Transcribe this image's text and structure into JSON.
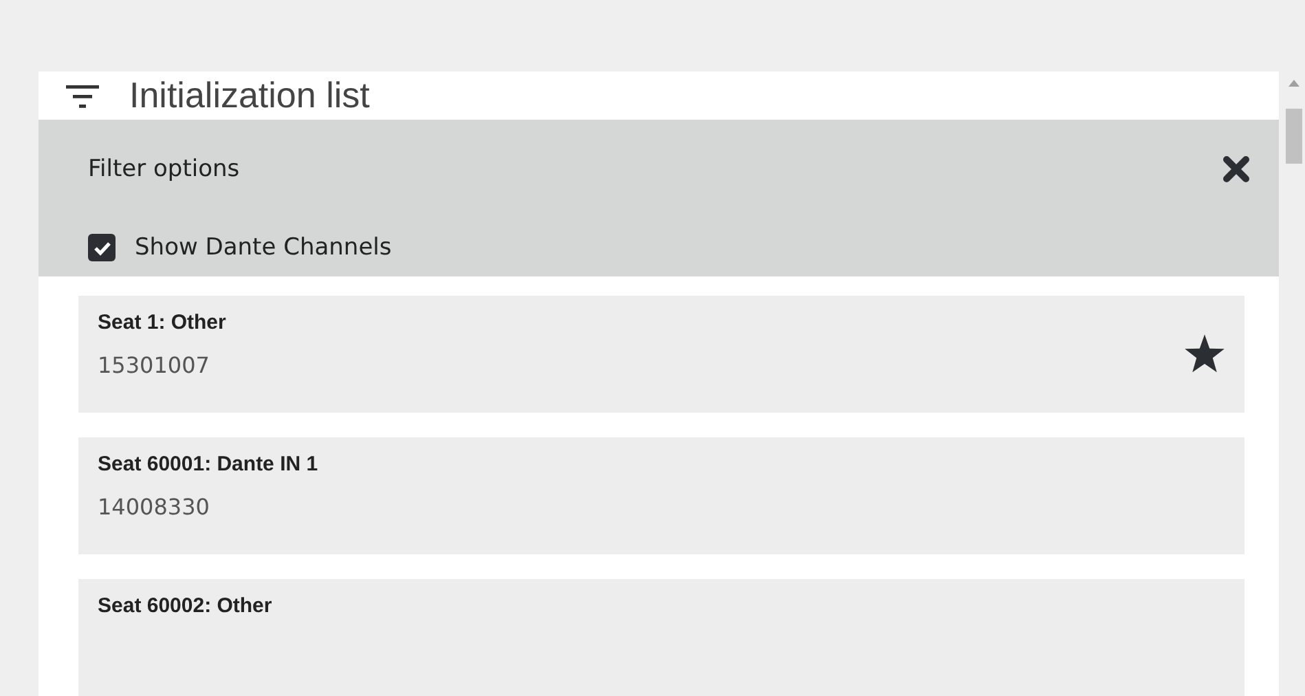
{
  "header": {
    "title": "Initialization list"
  },
  "filter_panel": {
    "title": "Filter options",
    "options": [
      {
        "label": "Show Dante Channels",
        "checked": true
      }
    ]
  },
  "items": [
    {
      "title": "Seat 1: Other",
      "number": "15301007",
      "favorite": true
    },
    {
      "title": "Seat 60001: Dante IN 1",
      "number": "14008330",
      "favorite": false
    },
    {
      "title": "Seat 60002: Other",
      "favorite": false
    }
  ]
}
